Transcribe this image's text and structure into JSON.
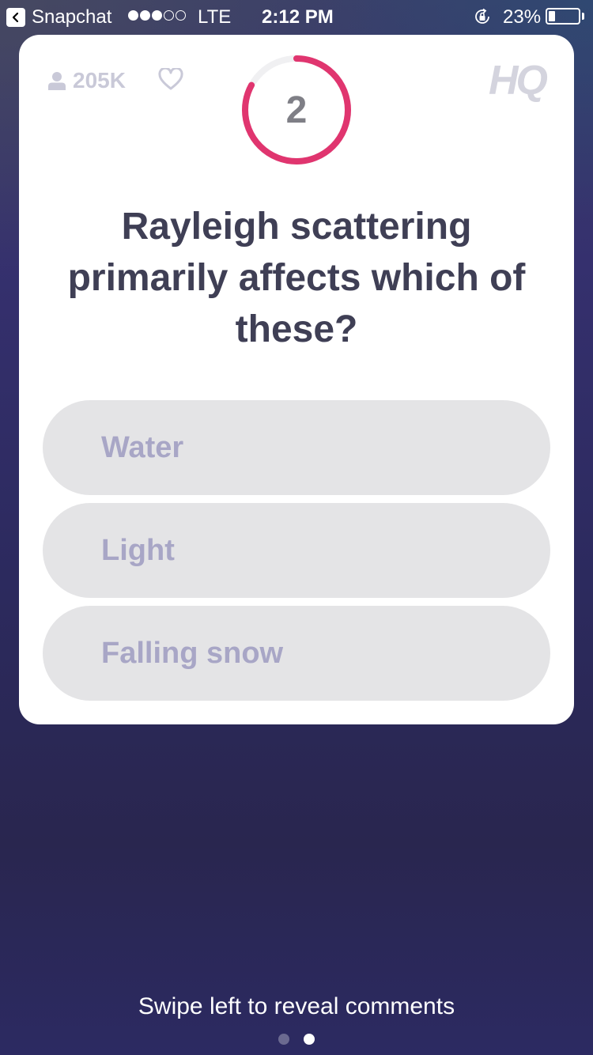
{
  "status_bar": {
    "back_app": "Snapchat",
    "carrier": "LTE",
    "time": "2:12 PM",
    "battery": "23%",
    "battery_level": 0.23,
    "signal_bars_filled": 3,
    "signal_bars_total": 5
  },
  "card": {
    "viewer_count": "205K",
    "logo": "HQ",
    "timer": {
      "value": "2",
      "progress": 0.83,
      "accent": "#e0356f"
    },
    "question": "Rayleigh scattering primarily affects which of these?",
    "answers": [
      {
        "label": "Water"
      },
      {
        "label": "Light"
      },
      {
        "label": "Falling snow"
      }
    ]
  },
  "footer": {
    "hint": "Swipe left to reveal comments",
    "pages": 2,
    "active_page": 1
  },
  "icons": {
    "back": "back-chevron-icon",
    "person": "person-icon",
    "heart": "heart-icon",
    "orientation_lock": "orientation-lock-icon"
  }
}
